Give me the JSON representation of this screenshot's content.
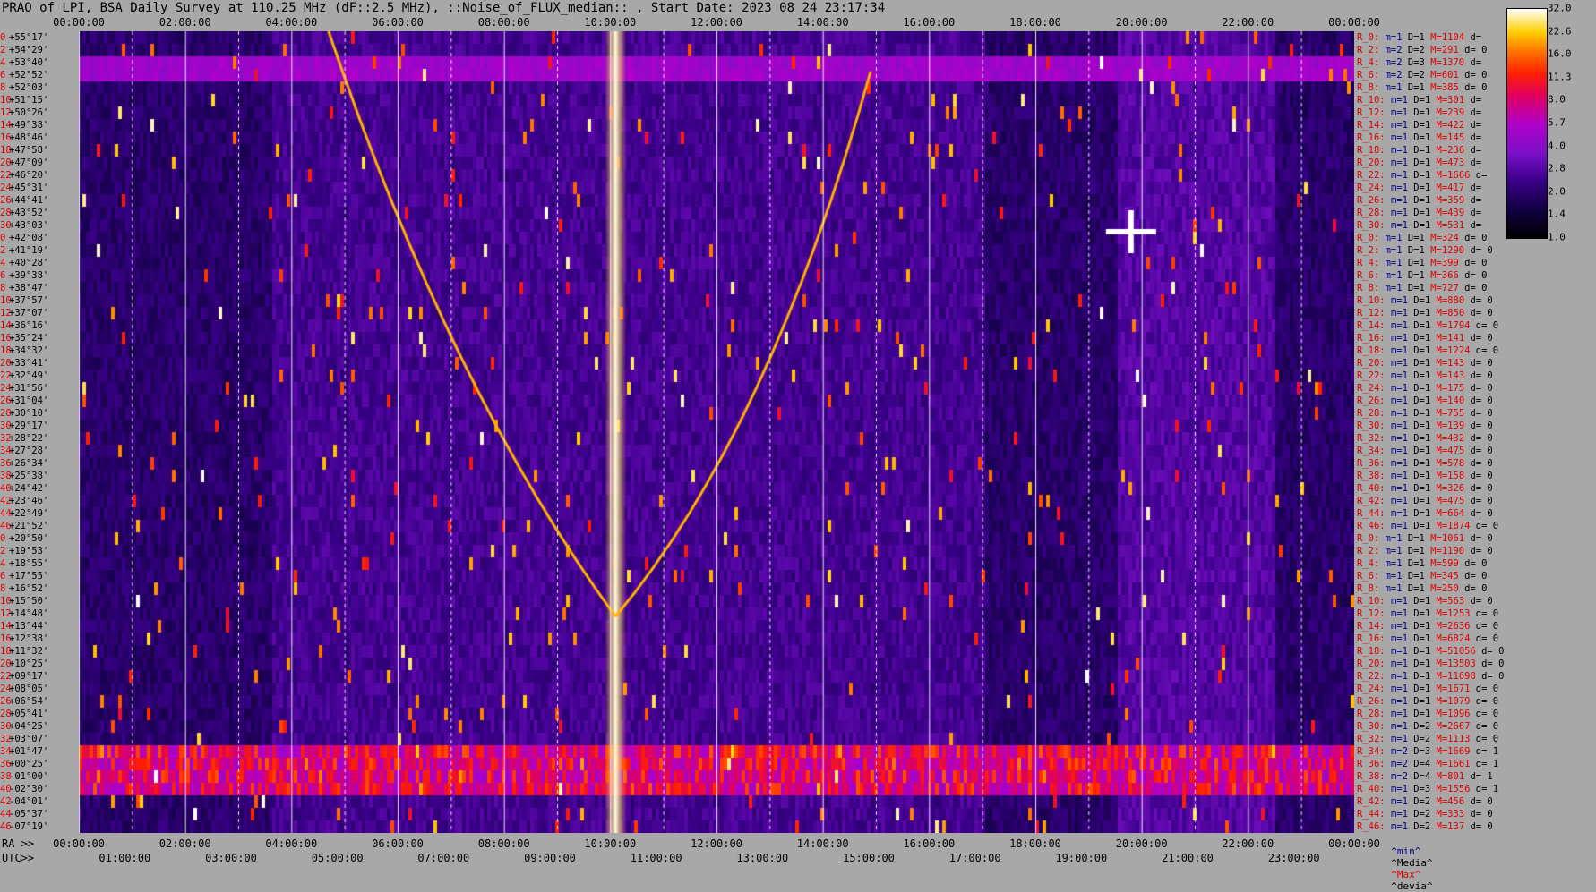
{
  "header": {
    "title": "PRAO of LPI, BSA Daily Survey at 110.25 MHz (dF::2.5 MHz), ::Noise_of_FLUX_median:: , Start Date: 2023 08 24 23:17:34"
  },
  "axes": {
    "top_ticks": [
      "00:00:00",
      "02:00:00",
      "04:00:00",
      "06:00:00",
      "08:00:00",
      "10:00:00",
      "12:00:00",
      "14:00:00",
      "16:00:00",
      "18:00:00",
      "20:00:00",
      "22:00:00",
      "00:00:00"
    ],
    "ra_label": "RA >>",
    "ra_ticks": [
      "00:00:00",
      "02:00:00",
      "04:00:00",
      "06:00:00",
      "08:00:00",
      "10:00:00",
      "12:00:00",
      "14:00:00",
      "16:00:00",
      "18:00:00",
      "20:00:00",
      "22:00:00",
      "00:00:00"
    ],
    "utc_label": "UTC>>",
    "utc_ticks": [
      "01:00:00",
      "03:00:00",
      "05:00:00",
      "07:00:00",
      "09:00:00",
      "11:00:00",
      "13:00:00",
      "15:00:00",
      "17:00:00",
      "19:00:00",
      "21:00:00",
      "23:00:00"
    ],
    "dec_labels": [
      "+55°17'",
      "+54°29'",
      "+53°40'",
      "+52°52'",
      "+52°03'",
      "+51°15'",
      "+50°26'",
      "+49°38'",
      "+48°46'",
      "+47°58'",
      "+47°09'",
      "+46°20'",
      "+45°31'",
      "+44°41'",
      "+43°52'",
      "+43°03'",
      "+42°08'",
      "+41°19'",
      "+40°28'",
      "+39°38'",
      "+38°47'",
      "+37°57'",
      "+37°07'",
      "+36°16'",
      "+35°24'",
      "+34°32'",
      "+33°41'",
      "+32°49'",
      "+31°56'",
      "+31°04'",
      "+30°10'",
      "+29°17'",
      "+28°22'",
      "+27°28'",
      "+26°34'",
      "+25°38'",
      "+24°42'",
      "+23°46'",
      "+22°49'",
      "+21°52'",
      "+20°50'",
      "+19°53'",
      "+18°55'",
      "+17°55'",
      "+16°52'",
      "+15°50'",
      "+14°48'",
      "+13°44'",
      "+12°38'",
      "+11°32'",
      "+10°25'",
      "+09°17'",
      "+08°05'",
      "+06°54'",
      "+05°41'",
      "+04°25'",
      "+03°07'",
      "+01°47'",
      "+00°25'",
      "-01°00'",
      "-02°30'",
      "-04°01'",
      "-05°37'",
      "-07°19'"
    ],
    "dec_index": [
      "0",
      "2",
      "4",
      "6",
      "8",
      "10",
      "12",
      "14",
      "16",
      "18",
      "20",
      "22",
      "24",
      "26",
      "28",
      "30",
      "0",
      "2",
      "4",
      "6",
      "8",
      "10",
      "12",
      "14",
      "16",
      "18",
      "20",
      "22",
      "24",
      "26",
      "28",
      "30",
      "32",
      "34",
      "36",
      "38",
      "40",
      "42",
      "44",
      "46",
      "0",
      "2",
      "4",
      "6",
      "8",
      "10",
      "12",
      "14",
      "16",
      "18",
      "20",
      "22",
      "24",
      "26",
      "28",
      "30",
      "32",
      "34",
      "36",
      "38",
      "40",
      "42",
      "44",
      "46"
    ]
  },
  "colorbar": {
    "ticks": [
      "32.0",
      "22.6",
      "16.0",
      "11.3",
      "8.0",
      "5.7",
      "4.0",
      "2.8",
      "2.0",
      "1.4",
      "1.0"
    ]
  },
  "right_panel": {
    "rows": [
      [
        "R_0:",
        "m=1",
        "D=1",
        "M=1104",
        "d="
      ],
      [
        "R_2:",
        "m=2",
        "D=2",
        "M=291",
        "d= 0"
      ],
      [
        "R_4:",
        "m=2",
        "D=3",
        "M=1370",
        "d="
      ],
      [
        "R_6:",
        "m=2",
        "D=2",
        "M=601",
        "d= 0"
      ],
      [
        "R_8:",
        "m=1",
        "D=1",
        "M=385",
        "d= 0"
      ],
      [
        "R_10:",
        "m=1",
        "D=1",
        "M=301",
        "d="
      ],
      [
        "R_12:",
        "m=1",
        "D=1",
        "M=239",
        "d="
      ],
      [
        "R_14:",
        "m=1",
        "D=1",
        "M=422",
        "d="
      ],
      [
        "R_16:",
        "m=1",
        "D=1",
        "M=145",
        "d="
      ],
      [
        "R_18:",
        "m=1",
        "D=1",
        "M=236",
        "d="
      ],
      [
        "R_20:",
        "m=1",
        "D=1",
        "M=473",
        "d="
      ],
      [
        "R_22:",
        "m=1",
        "D=1",
        "M=1666",
        "d="
      ],
      [
        "R_24:",
        "m=1",
        "D=1",
        "M=417",
        "d="
      ],
      [
        "R_26:",
        "m=1",
        "D=1",
        "M=359",
        "d="
      ],
      [
        "R_28:",
        "m=1",
        "D=1",
        "M=439",
        "d="
      ],
      [
        "R_30:",
        "m=1",
        "D=1",
        "M=531",
        "d="
      ],
      [
        "R_0:",
        "m=1",
        "D=1",
        "M=324",
        "d= 0"
      ],
      [
        "R_2:",
        "m=1",
        "D=1",
        "M=1290",
        "d= 0"
      ],
      [
        "R_4:",
        "m=1",
        "D=1",
        "M=399",
        "d= 0"
      ],
      [
        "R_6:",
        "m=1",
        "D=1",
        "M=366",
        "d= 0"
      ],
      [
        "R_8:",
        "m=1",
        "D=1",
        "M=727",
        "d= 0"
      ],
      [
        "R_10:",
        "m=1",
        "D=1",
        "M=880",
        "d= 0"
      ],
      [
        "R_12:",
        "m=1",
        "D=1",
        "M=850",
        "d= 0"
      ],
      [
        "R_14:",
        "m=1",
        "D=1",
        "M=1794",
        "d= 0"
      ],
      [
        "R_16:",
        "m=1",
        "D=1",
        "M=141",
        "d= 0"
      ],
      [
        "R_18:",
        "m=1",
        "D=1",
        "M=1224",
        "d= 0"
      ],
      [
        "R_20:",
        "m=1",
        "D=1",
        "M=143",
        "d= 0"
      ],
      [
        "R_22:",
        "m=1",
        "D=1",
        "M=143",
        "d= 0"
      ],
      [
        "R_24:",
        "m=1",
        "D=1",
        "M=175",
        "d= 0"
      ],
      [
        "R_26:",
        "m=1",
        "D=1",
        "M=140",
        "d= 0"
      ],
      [
        "R_28:",
        "m=1",
        "D=1",
        "M=755",
        "d= 0"
      ],
      [
        "R_30:",
        "m=1",
        "D=1",
        "M=139",
        "d= 0"
      ],
      [
        "R_32:",
        "m=1",
        "D=1",
        "M=432",
        "d= 0"
      ],
      [
        "R_34:",
        "m=1",
        "D=1",
        "M=475",
        "d= 0"
      ],
      [
        "R_36:",
        "m=1",
        "D=1",
        "M=578",
        "d= 0"
      ],
      [
        "R_38:",
        "m=1",
        "D=1",
        "M=158",
        "d= 0"
      ],
      [
        "R_40:",
        "m=1",
        "D=1",
        "M=326",
        "d= 0"
      ],
      [
        "R_42:",
        "m=1",
        "D=1",
        "M=475",
        "d= 0"
      ],
      [
        "R_44:",
        "m=1",
        "D=1",
        "M=664",
        "d= 0"
      ],
      [
        "R_46:",
        "m=1",
        "D=1",
        "M=1874",
        "d= 0"
      ],
      [
        "R_0:",
        "m=1",
        "D=1",
        "M=1061",
        "d= 0"
      ],
      [
        "R_2:",
        "m=1",
        "D=1",
        "M=1190",
        "d= 0"
      ],
      [
        "R_4:",
        "m=1",
        "D=1",
        "M=599",
        "d= 0"
      ],
      [
        "R_6:",
        "m=1",
        "D=1",
        "M=345",
        "d= 0"
      ],
      [
        "R_8:",
        "m=1",
        "D=1",
        "M=250",
        "d= 0"
      ],
      [
        "R_10:",
        "m=1",
        "D=1",
        "M=563",
        "d= 0"
      ],
      [
        "R_12:",
        "m=1",
        "D=1",
        "M=1253",
        "d= 0"
      ],
      [
        "R_14:",
        "m=1",
        "D=1",
        "M=2636",
        "d= 0"
      ],
      [
        "R_16:",
        "m=1",
        "D=1",
        "M=6824",
        "d= 0"
      ],
      [
        "R_18:",
        "m=1",
        "D=1",
        "M=51056",
        "d= 0"
      ],
      [
        "R_20:",
        "m=1",
        "D=1",
        "M=13503",
        "d= 0"
      ],
      [
        "R_22:",
        "m=1",
        "D=1",
        "M=11698",
        "d= 0"
      ],
      [
        "R_24:",
        "m=1",
        "D=1",
        "M=1671",
        "d= 0"
      ],
      [
        "R_26:",
        "m=1",
        "D=1",
        "M=1079",
        "d= 0"
      ],
      [
        "R_28:",
        "m=1",
        "D=1",
        "M=1096",
        "d= 0"
      ],
      [
        "R_30:",
        "m=1",
        "D=2",
        "M=2667",
        "d= 0"
      ],
      [
        "R_32:",
        "m=1",
        "D=2",
        "M=1113",
        "d= 0"
      ],
      [
        "R_34:",
        "m=2",
        "D=3",
        "M=1669",
        "d= 1"
      ],
      [
        "R_36:",
        "m=2",
        "D=4",
        "M=1661",
        "d= 1"
      ],
      [
        "R_38:",
        "m=2",
        "D=4",
        "M=801",
        "d= 1"
      ],
      [
        "R_40:",
        "m=1",
        "D=3",
        "M=1556",
        "d= 1"
      ],
      [
        "R_42:",
        "m=1",
        "D=2",
        "M=456",
        "d= 0"
      ],
      [
        "R_44:",
        "m=1",
        "D=2",
        "M=333",
        "d= 0"
      ],
      [
        "R_46:",
        "m=1",
        "D=2",
        "M=137",
        "d= 0"
      ]
    ],
    "legend": [
      "^min^",
      "^Media^",
      "^Max^",
      "^devia^"
    ]
  },
  "chart_data": {
    "type": "heatmap",
    "title": "PRAO of LPI, BSA Daily Survey at 110.25 MHz (dF::2.5 MHz), ::Noise_of_FLUX_median:: , Start Date: 2023 08 24 23:17:34",
    "xlabel": "RA >> / UTC>>",
    "ylabel": "",
    "x_range_hours": [
      0,
      24
    ],
    "dec_range_deg": [
      -7.32,
      55.28
    ],
    "color_scale": "log",
    "colorbar_range": [
      1.0,
      32.0
    ],
    "rows": 64,
    "colors": {
      "low": "#000000",
      "mid": "#7a10c8",
      "high": "#ff2000",
      "peak": "#ffffff"
    }
  }
}
